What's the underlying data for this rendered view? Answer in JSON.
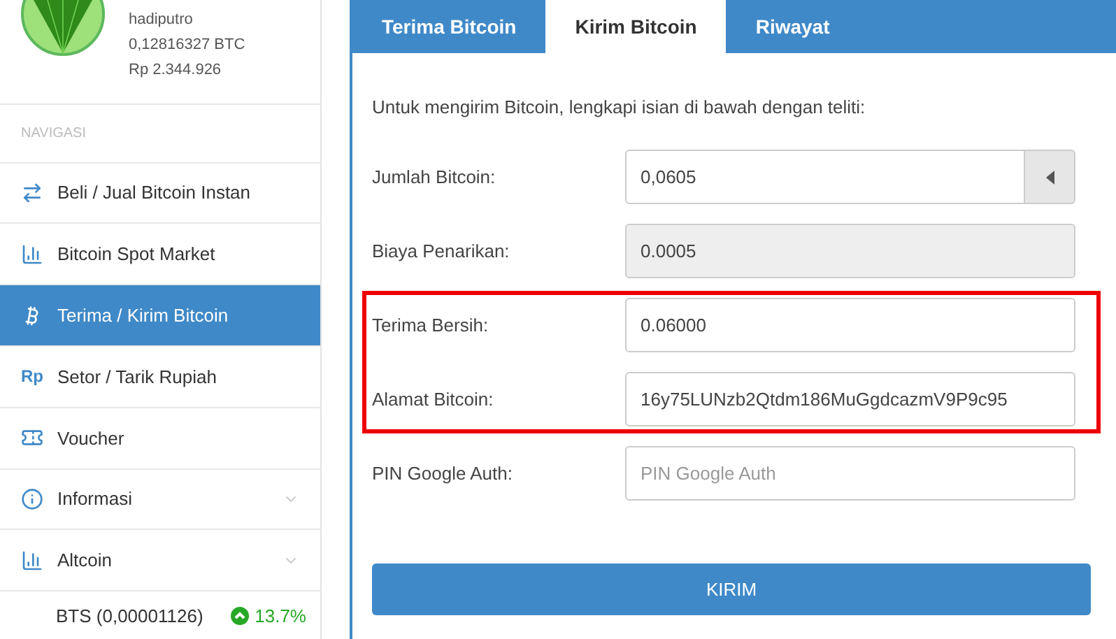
{
  "profile": {
    "username": "hadiputro",
    "btc_balance": "0,12816327 BTC",
    "idr_balance": "Rp 2.344.926"
  },
  "sidebar": {
    "heading": "NAVIGASI",
    "items": [
      {
        "label": "Beli / Jual Bitcoin Instan",
        "selected": false
      },
      {
        "label": "Bitcoin Spot Market",
        "selected": false
      },
      {
        "label": "Terima / Kirim Bitcoin",
        "selected": true
      },
      {
        "label": "Setor / Tarik Rupiah",
        "selected": false,
        "icon_text": "Rp"
      },
      {
        "label": "Voucher",
        "selected": false
      },
      {
        "label": "Informasi",
        "selected": false,
        "expanded": false
      },
      {
        "label": "Altcoin",
        "selected": false,
        "expanded": false
      }
    ],
    "ticker": {
      "label": "BTS (0,00001126)",
      "change": "13.7%",
      "rising": true
    }
  },
  "tabs": [
    {
      "label": "Terima Bitcoin",
      "selected": false
    },
    {
      "label": "Kirim Bitcoin",
      "selected": true
    },
    {
      "label": "Riwayat",
      "selected": false
    }
  ],
  "form": {
    "intro": "Untuk mengirim Bitcoin, lengkapi isian di bawah dengan teliti:",
    "fields": [
      {
        "label": "Jumlah Bitcoin:",
        "value": "0,0605",
        "kind": "spinner",
        "disabled": false,
        "highlighted": false
      },
      {
        "label": "Biaya Penarikan:",
        "value": "0.0005",
        "kind": "text",
        "disabled": true,
        "highlighted": false
      },
      {
        "label": "Terima Bersih:",
        "value": "0.06000",
        "kind": "text",
        "disabled": false,
        "highlighted": true
      },
      {
        "label": "Alamat Bitcoin:",
        "value": "16y75LUNzb2Qtdm186MuGgdcazmV9P9c95",
        "kind": "text",
        "disabled": false,
        "highlighted": true
      },
      {
        "label": "PIN Google Auth:",
        "placeholder": "PIN Google Auth",
        "kind": "text",
        "disabled": false,
        "highlighted": false
      }
    ],
    "submit": "KIRIM"
  }
}
